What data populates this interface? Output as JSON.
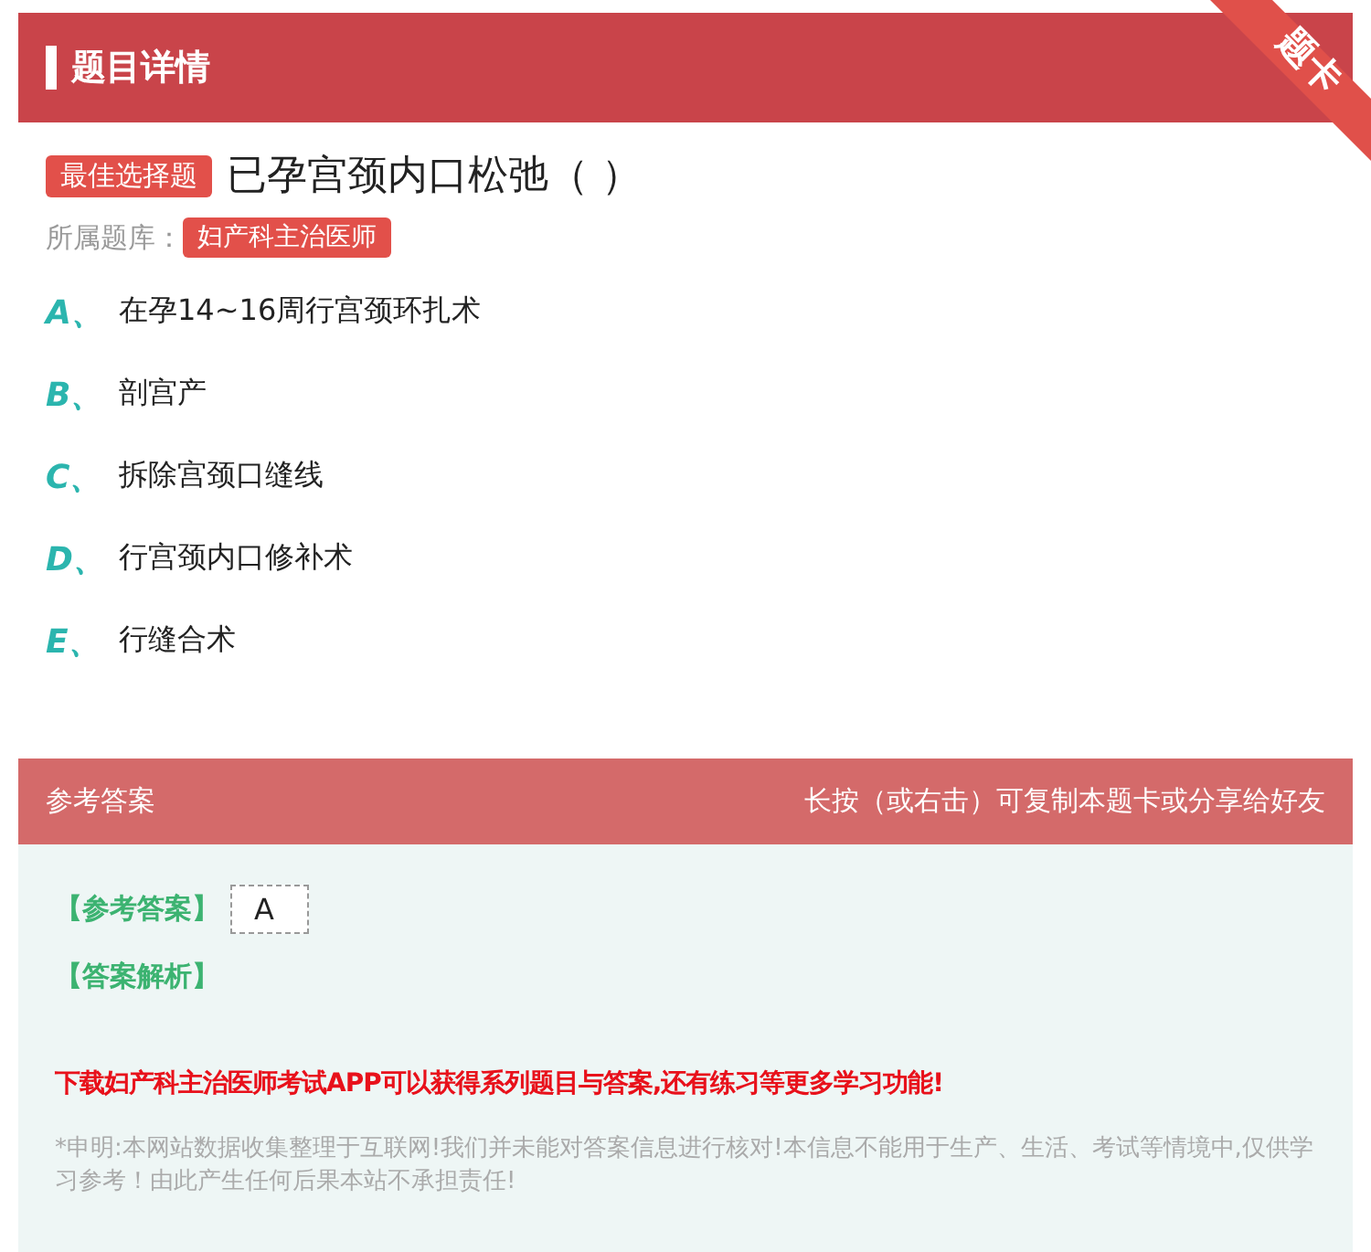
{
  "header": {
    "title": "题目详情",
    "ribbon": "题卡"
  },
  "question": {
    "type_badge": "最佳选择题",
    "text": "已孕宫颈内口松弛（ ）",
    "bank_label": "所属题库：",
    "bank": "妇产科主治医师"
  },
  "options": [
    {
      "letter": "A、",
      "text": "在孕14~16周行宫颈环扎术"
    },
    {
      "letter": "B、",
      "text": "剖宫产"
    },
    {
      "letter": "C、",
      "text": "拆除宫颈口缝线"
    },
    {
      "letter": "D、",
      "text": "行宫颈内口修补术"
    },
    {
      "letter": "E、",
      "text": "行缝合术"
    }
  ],
  "answer_section": {
    "title": "参考答案",
    "hint": "长按（或右击）可复制本题卡或分享给好友",
    "answer_label": "【参考答案】",
    "answer": "A",
    "analysis_label": "【答案解析】",
    "promo": "下载妇产科主治医师考试APP可以获得系列题目与答案,还有练习等更多学习功能!",
    "disclaimer": "*申明:本网站数据收集整理于互联网!我们并未能对答案信息进行核对!本信息不能用于生产、生活、考试等情境中,仅供学习参考！由此产生任何后果本站不承担责任!"
  }
}
